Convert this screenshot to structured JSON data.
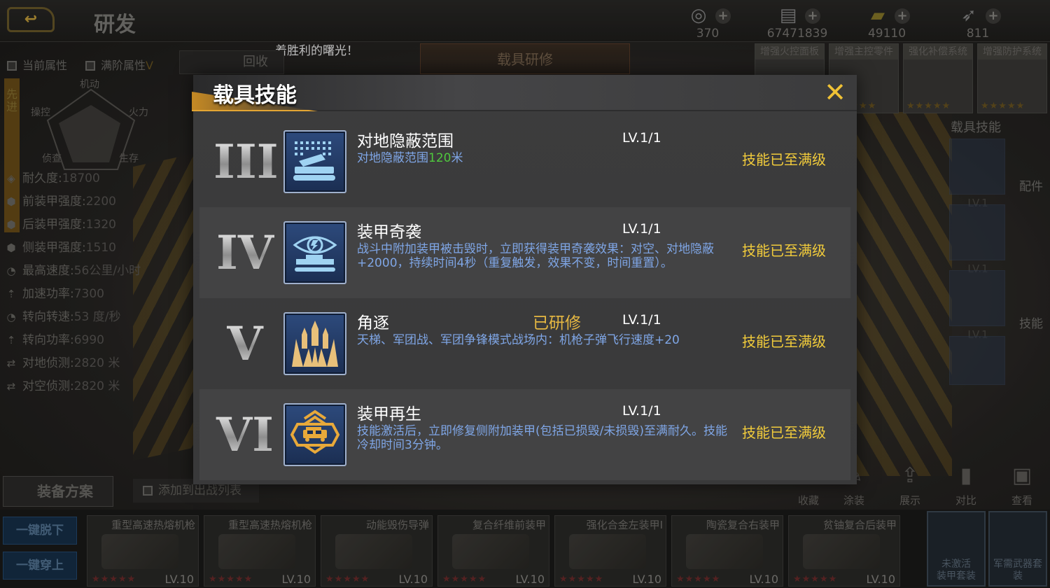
{
  "header": {
    "back_icon": "back-arrow-icon",
    "title": "研发",
    "resources": [
      {
        "icon": "medal-icon",
        "value": "370"
      },
      {
        "icon": "cash-icon",
        "value": "67471839"
      },
      {
        "icon": "gold-bar-icon",
        "value": "49110"
      },
      {
        "icon": "rocket-icon",
        "value": "811"
      }
    ]
  },
  "banner_text": "着胜利的曙光！",
  "background": {
    "toggles": {
      "current": "当前属性",
      "max": "满阶属性",
      "max_mark": "V"
    },
    "recycle": "回收",
    "center_tab": "载具研修",
    "side_tab": "先进",
    "radar_labels": [
      "机动",
      "操控",
      "火力",
      "侦查",
      "生存"
    ],
    "stats": [
      {
        "label": "耐久度:",
        "value": "18700"
      },
      {
        "label": "前装甲强度:",
        "value": "2200"
      },
      {
        "label": "后装甲强度:",
        "value": "1320"
      },
      {
        "label": "侧装甲强度:",
        "value": "1510"
      },
      {
        "label": "最高速度:",
        "value": "56公里/小时"
      },
      {
        "label": "加速功率:",
        "value": "7300"
      },
      {
        "label": "转向转速:",
        "value": "53 度/秒"
      },
      {
        "label": "转向功率:",
        "value": "6990"
      },
      {
        "label": "对地侦测:",
        "value": "2820 米"
      },
      {
        "label": "对空侦测:",
        "value": "2820 米"
      }
    ],
    "upgrades": [
      "增强火控面板",
      "增强主控零件",
      "强化补偿系统",
      "增强防护系统"
    ],
    "upgrade_stars": "★★★★★",
    "skill_column_title": "载具技能",
    "skill_column_levels": [
      "LV.1",
      "LV.1",
      "LV.1"
    ],
    "side_words": {
      "parts": "配件",
      "skills": "技能"
    },
    "bottom_actions": [
      "收藏",
      "涂装",
      "展示",
      "对比",
      "查看"
    ],
    "plan_button": "装备方案",
    "add_to_battle": "添加到出战列表",
    "quick_buttons": {
      "unequip": "一键脱下",
      "equip": "一键穿上"
    },
    "equipment": [
      {
        "name": "重型高速热熔机枪",
        "level": "LV.10"
      },
      {
        "name": "重型高速热熔机枪",
        "level": "LV.10"
      },
      {
        "name": "动能毁伤导弹",
        "level": "LV.10"
      },
      {
        "name": "复合纤维前装甲",
        "level": "LV.10"
      },
      {
        "name": "强化合金左装甲I",
        "level": "LV.10"
      },
      {
        "name": "陶瓷复合右装甲",
        "level": "LV.10"
      },
      {
        "name": "贫铀复合后装甲",
        "level": "LV.10"
      }
    ],
    "equip_stars": "★★★★★",
    "set_cards": [
      {
        "line1": "未激活",
        "line2": "装甲套装"
      },
      {
        "line1": "",
        "line2": "军需武器套装"
      }
    ]
  },
  "modal": {
    "title": "载具技能",
    "close_icon": "close-x-icon",
    "skills": [
      {
        "tier": "III",
        "icon": "camouflage-tank-icon",
        "name": "对地隐蔽范围",
        "status": "",
        "level": "LV.1/1",
        "desc_prefix": "对地隐蔽范围",
        "desc_highlight": "120",
        "desc_suffix": "米",
        "max": "技能已至满级"
      },
      {
        "tier": "IV",
        "icon": "armor-ambush-eye-icon",
        "name": "装甲奇袭",
        "status": "",
        "level": "LV.1/1",
        "desc_prefix": "战斗中附加装甲被击毁时，立即获得装甲奇袭效果：对空、对地隐蔽+2000，持续时间4秒（重复触发，效果不变，时间重置）。",
        "desc_highlight": "",
        "desc_suffix": "",
        "max": "技能已至满级"
      },
      {
        "tier": "V",
        "icon": "bullet-volley-icon",
        "name": "角逐",
        "status": "已研修",
        "level": "LV.1/1",
        "desc_prefix": "天梯、军团战、军团争锋模式战场内：机枪子弹飞行速度+20",
        "desc_highlight": "",
        "desc_suffix": "",
        "max": "技能已至满级"
      },
      {
        "tier": "VI",
        "icon": "armor-regen-icon",
        "name": "装甲再生",
        "status": "",
        "level": "LV.1/1",
        "desc_prefix": "技能激活后，立即修复侧附加装甲(包括已损毁/未损毁)至满耐久。技能冷却时间3分钟。",
        "desc_highlight": "",
        "desc_suffix": "",
        "max": "技能已至满级"
      }
    ]
  }
}
